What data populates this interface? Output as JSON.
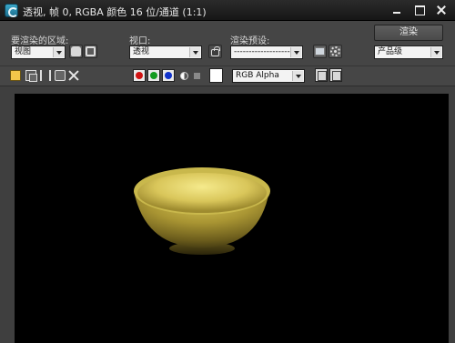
{
  "window": {
    "title": "透视, 帧 0, RGBA 颜色 16 位/通道 (1:1)"
  },
  "render_settings": {
    "area_label": "要渲染的区域:",
    "area_value": "视图",
    "viewport_label": "视口:",
    "viewport_value": "透视",
    "preset_label": "渲染预设:",
    "preset_value": "-------------------",
    "render_button": "渲染",
    "quality_value": "产品级"
  },
  "toolbar": {
    "channel_value": "RGB Alpha",
    "swatch_color": "#ffffff"
  },
  "channels": {
    "red": "#d01212",
    "green": "#139b20",
    "blue": "#1133cc"
  },
  "viewport": {
    "background": "#000000",
    "content": "bowl"
  }
}
